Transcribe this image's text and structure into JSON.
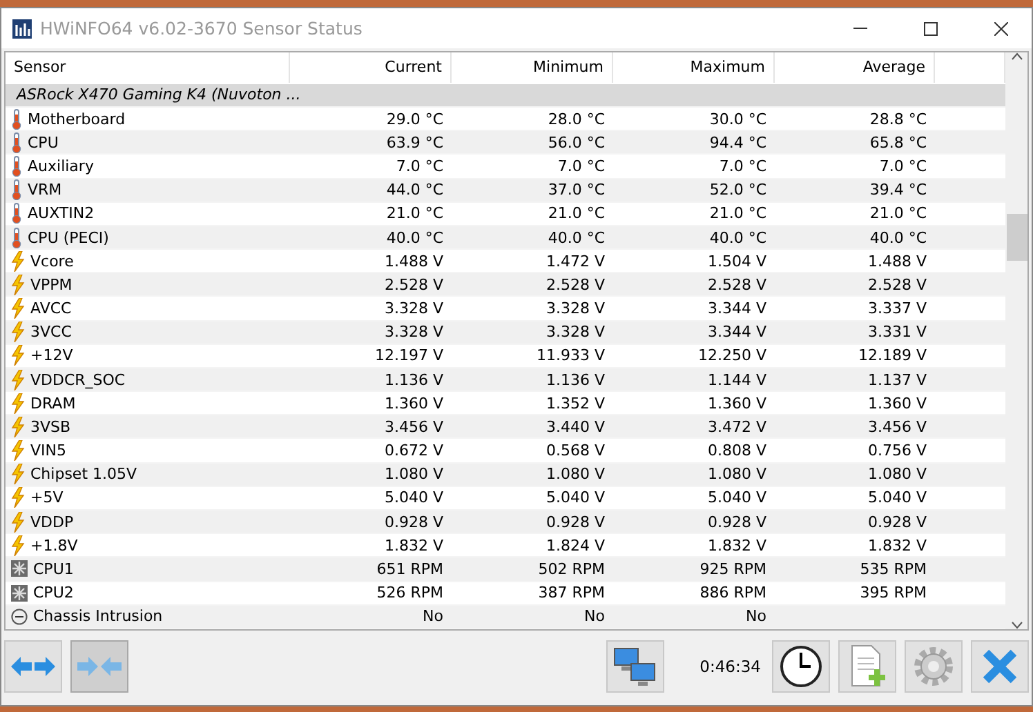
{
  "window": {
    "title": "HWiNFO64 v6.02-3670 Sensor Status"
  },
  "table": {
    "columns": [
      "Sensor",
      "Current",
      "Minimum",
      "Maximum",
      "Average"
    ],
    "rows": [
      {
        "kind": "chip",
        "name": "ASRock X470 Gaming K4 (Nuvoton ...",
        "values": []
      },
      {
        "kind": "temp",
        "name": "Motherboard",
        "values": [
          "29.0 °C",
          "28.0 °C",
          "30.0 °C",
          "28.8 °C"
        ]
      },
      {
        "kind": "temp",
        "name": "CPU",
        "values": [
          "63.9 °C",
          "56.0 °C",
          "94.4 °C",
          "65.8 °C"
        ]
      },
      {
        "kind": "temp",
        "name": "Auxiliary",
        "values": [
          "7.0 °C",
          "7.0 °C",
          "7.0 °C",
          "7.0 °C"
        ]
      },
      {
        "kind": "temp",
        "name": "VRM",
        "values": [
          "44.0 °C",
          "37.0 °C",
          "52.0 °C",
          "39.4 °C"
        ]
      },
      {
        "kind": "temp",
        "name": "AUXTIN2",
        "values": [
          "21.0 °C",
          "21.0 °C",
          "21.0 °C",
          "21.0 °C"
        ]
      },
      {
        "kind": "temp",
        "name": "CPU (PECI)",
        "values": [
          "40.0 °C",
          "40.0 °C",
          "40.0 °C",
          "40.0 °C"
        ]
      },
      {
        "kind": "volt",
        "name": "Vcore",
        "values": [
          "1.488 V",
          "1.472 V",
          "1.504 V",
          "1.488 V"
        ]
      },
      {
        "kind": "volt",
        "name": "VPPM",
        "values": [
          "2.528 V",
          "2.528 V",
          "2.528 V",
          "2.528 V"
        ]
      },
      {
        "kind": "volt",
        "name": "AVCC",
        "values": [
          "3.328 V",
          "3.328 V",
          "3.344 V",
          "3.337 V"
        ]
      },
      {
        "kind": "volt",
        "name": "3VCC",
        "values": [
          "3.328 V",
          "3.328 V",
          "3.344 V",
          "3.331 V"
        ]
      },
      {
        "kind": "volt",
        "name": "+12V",
        "values": [
          "12.197 V",
          "11.933 V",
          "12.250 V",
          "12.189 V"
        ]
      },
      {
        "kind": "volt",
        "name": "VDDCR_SOC",
        "values": [
          "1.136 V",
          "1.136 V",
          "1.144 V",
          "1.137 V"
        ]
      },
      {
        "kind": "volt",
        "name": "DRAM",
        "values": [
          "1.360 V",
          "1.352 V",
          "1.360 V",
          "1.360 V"
        ]
      },
      {
        "kind": "volt",
        "name": "3VSB",
        "values": [
          "3.456 V",
          "3.440 V",
          "3.472 V",
          "3.456 V"
        ]
      },
      {
        "kind": "volt",
        "name": "VIN5",
        "values": [
          "0.672 V",
          "0.568 V",
          "0.808 V",
          "0.756 V"
        ]
      },
      {
        "kind": "volt",
        "name": "Chipset 1.05V",
        "values": [
          "1.080 V",
          "1.080 V",
          "1.080 V",
          "1.080 V"
        ]
      },
      {
        "kind": "volt",
        "name": "+5V",
        "values": [
          "5.040 V",
          "5.040 V",
          "5.040 V",
          "5.040 V"
        ]
      },
      {
        "kind": "volt",
        "name": "VDDP",
        "values": [
          "0.928 V",
          "0.928 V",
          "0.928 V",
          "0.928 V"
        ]
      },
      {
        "kind": "volt",
        "name": "+1.8V",
        "values": [
          "1.832 V",
          "1.824 V",
          "1.832 V",
          "1.832 V"
        ]
      },
      {
        "kind": "fan",
        "name": "CPU1",
        "values": [
          "651 RPM",
          "502 RPM",
          "925 RPM",
          "535 RPM"
        ]
      },
      {
        "kind": "fan",
        "name": "CPU2",
        "values": [
          "526 RPM",
          "387 RPM",
          "886 RPM",
          "395 RPM"
        ]
      },
      {
        "kind": "intrusion",
        "name": "Chassis Intrusion",
        "values": [
          "No",
          "No",
          "No"
        ]
      }
    ]
  },
  "toolbar": {
    "left": [
      {
        "kind": "expand",
        "pressed": false
      },
      {
        "kind": "collapse",
        "pressed": true
      }
    ],
    "network": {
      "kind": "network",
      "pressed": false
    },
    "elapsed": "0:46:34",
    "right": [
      {
        "kind": "clock",
        "pressed": false
      },
      {
        "kind": "report",
        "pressed": false
      },
      {
        "kind": "settings",
        "pressed": false
      },
      {
        "kind": "close",
        "pressed": false
      }
    ]
  }
}
